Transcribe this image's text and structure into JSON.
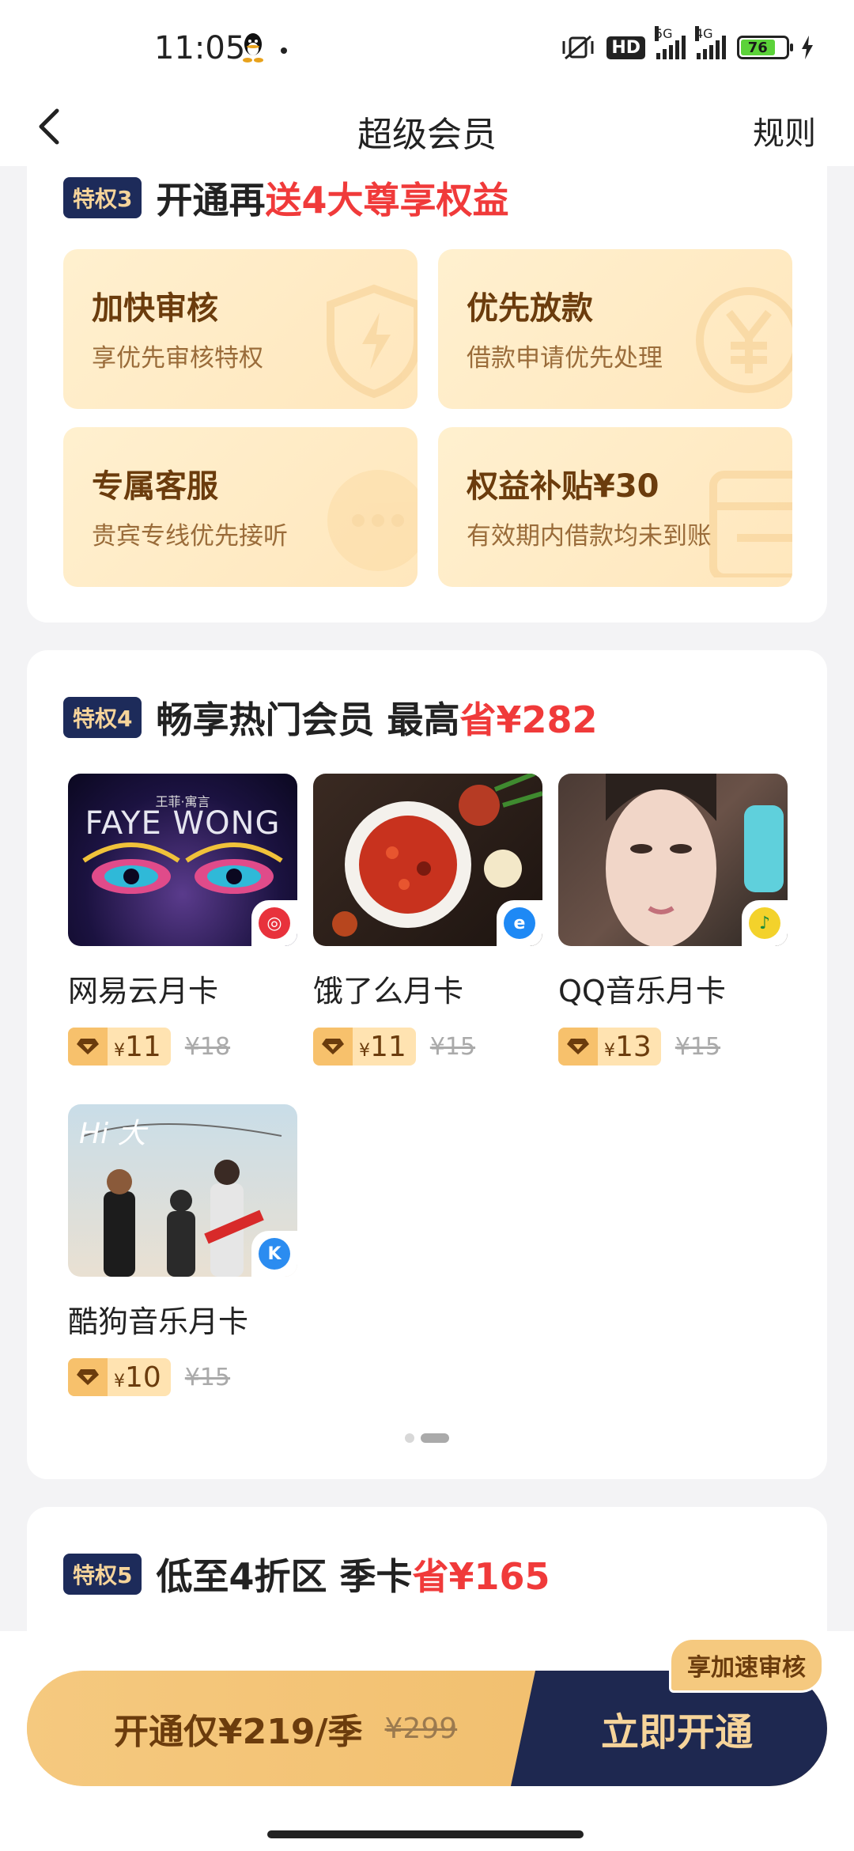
{
  "status": {
    "time": "11:05",
    "battery": "76",
    "net1": "5G",
    "net2": "4G",
    "hd": "HD"
  },
  "nav": {
    "title": "超级会员",
    "rules": "规则"
  },
  "sec3": {
    "badge": "特权3",
    "title_a": "开通再",
    "title_red": "送4大尊享权益",
    "benefits": [
      {
        "title": "加快审核",
        "desc": "享优先审核特权",
        "icon": "shield-lightning-icon"
      },
      {
        "title": "优先放款",
        "desc": "借款申请优先处理",
        "icon": "yuan-coin-icon"
      },
      {
        "title": "专属客服",
        "desc": "贵宾专线优先接听",
        "icon": "chat-bubble-icon"
      },
      {
        "title": "权益补贴¥30",
        "desc": "有效期内借款均未到账",
        "icon": "card-icon"
      }
    ]
  },
  "sec4": {
    "badge": "特权4",
    "title_a": "畅享热门会员 最高",
    "title_red": "省¥282",
    "items": [
      {
        "name": "网易云月卡",
        "price": "11",
        "orig": "¥18",
        "app": "netease-music-icon",
        "color": "#e8323c",
        "thumb_text": "FAYE WONG",
        "thumb_small": "王菲·寓言"
      },
      {
        "name": "饿了么月卡",
        "price": "11",
        "orig": "¥15",
        "app": "eleme-icon",
        "color": "#1e89f5"
      },
      {
        "name": "QQ音乐月卡",
        "price": "13",
        "orig": "¥15",
        "app": "qq-music-icon",
        "color": "#f3d22b"
      },
      {
        "name": "酷狗音乐月卡",
        "price": "10",
        "orig": "¥15",
        "app": "kugou-icon",
        "color": "#2b8cf0",
        "thumb_text": "Hi 大"
      }
    ],
    "currency": "¥"
  },
  "sec5": {
    "badge": "特权5",
    "title_a": "低至4折区 季卡",
    "title_red": "省¥165"
  },
  "cta": {
    "price": "开通仅¥219/季",
    "orig": "¥299",
    "button": "立即开通",
    "tip": "享加速审核"
  }
}
